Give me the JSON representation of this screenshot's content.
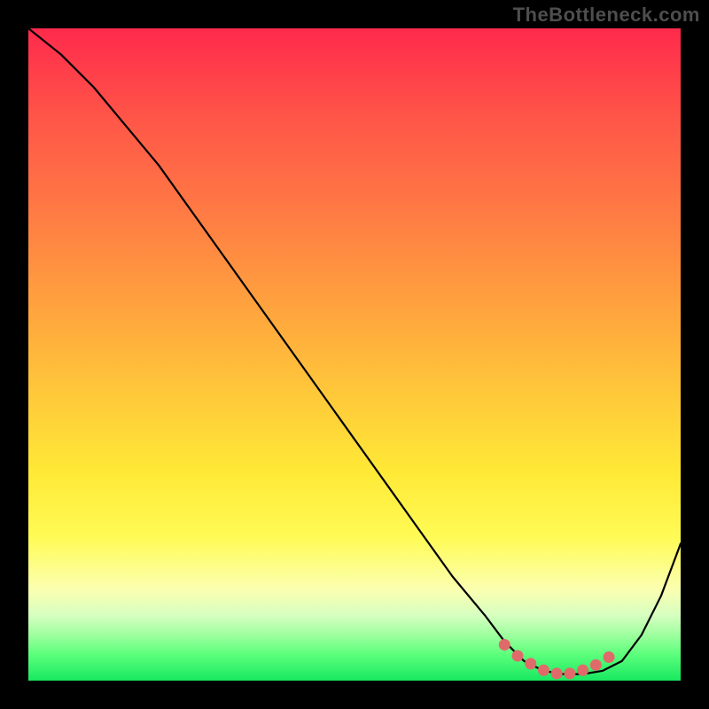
{
  "watermark": "TheBottleneck.com",
  "colors": {
    "background": "#000000",
    "curve": "#000000",
    "marker": "#e06a6a",
    "gradient_top": "#ff2a4c",
    "gradient_bottom": "#18e860"
  },
  "chart_data": {
    "type": "line",
    "title": "",
    "xlabel": "",
    "ylabel": "",
    "xlim": [
      0,
      100
    ],
    "ylim": [
      0,
      100
    ],
    "series": [
      {
        "name": "bottleneck-curve",
        "x": [
          0,
          5,
          10,
          15,
          20,
          25,
          30,
          35,
          40,
          45,
          50,
          55,
          60,
          65,
          70,
          73,
          76,
          79,
          82,
          85,
          88,
          91,
          94,
          97,
          100
        ],
        "y": [
          100,
          96,
          91,
          85,
          79,
          72,
          65,
          58,
          51,
          44,
          37,
          30,
          23,
          16,
          10,
          6,
          3,
          1.5,
          1,
          1,
          1.5,
          3,
          7,
          13,
          21
        ]
      }
    ],
    "markers": {
      "name": "optimal-range",
      "x": [
        73,
        75,
        77,
        79,
        81,
        83,
        85,
        87,
        89
      ],
      "y": [
        5.5,
        3.8,
        2.6,
        1.6,
        1.1,
        1.1,
        1.6,
        2.4,
        3.6
      ]
    }
  }
}
